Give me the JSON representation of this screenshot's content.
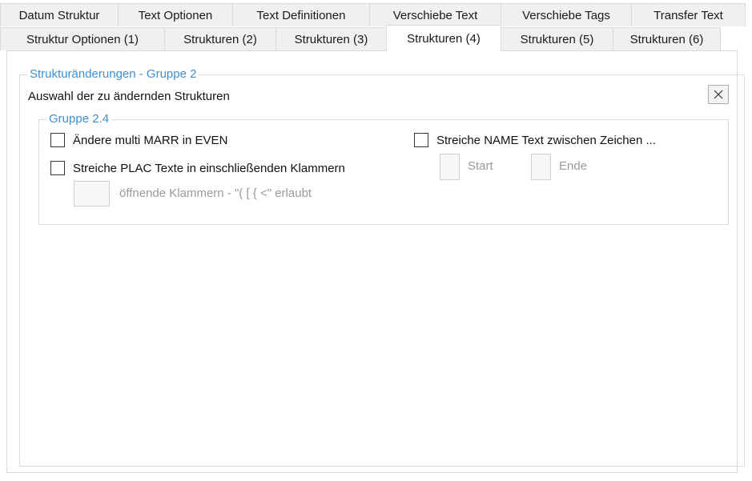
{
  "tabs_row1": [
    {
      "label": "Datum Struktur"
    },
    {
      "label": "Text Optionen"
    },
    {
      "label": "Text Definitionen"
    },
    {
      "label": "Verschiebe Text"
    },
    {
      "label": "Verschiebe Tags"
    },
    {
      "label": "Transfer Text"
    }
  ],
  "tabs_row2": [
    {
      "label": "Struktur Optionen (1)"
    },
    {
      "label": "Strukturen (2)"
    },
    {
      "label": "Strukturen (3)"
    },
    {
      "label": "Strukturen (4)",
      "selected": true
    },
    {
      "label": "Strukturen (5)"
    },
    {
      "label": "Strukturen (6)"
    }
  ],
  "group": {
    "title": "Strukturänderungen - Gruppe 2",
    "subtitle": "Auswahl der zu ändernden Strukturen",
    "close_icon": "close-icon"
  },
  "inner_group": {
    "title": "Gruppe 2.4",
    "options": {
      "marr": {
        "label": "Ändere multi MARR in EVEN",
        "checked": false
      },
      "plac": {
        "label": "Streiche PLAC Texte in einschließenden Klammern",
        "checked": false
      },
      "name": {
        "label": "Streiche NAME Text zwischen Zeichen ...",
        "checked": false
      }
    },
    "bracket_field": {
      "value": "",
      "label": "öffnende Klammern - \"( [ { <\" erlaubt"
    },
    "start_field": {
      "value": "",
      "label": "Start"
    },
    "end_field": {
      "value": "",
      "label": "Ende"
    }
  },
  "colors": {
    "accent": "#3d8fd1",
    "disabled_text": "#9a9a9a",
    "border": "#d9d9d9"
  }
}
